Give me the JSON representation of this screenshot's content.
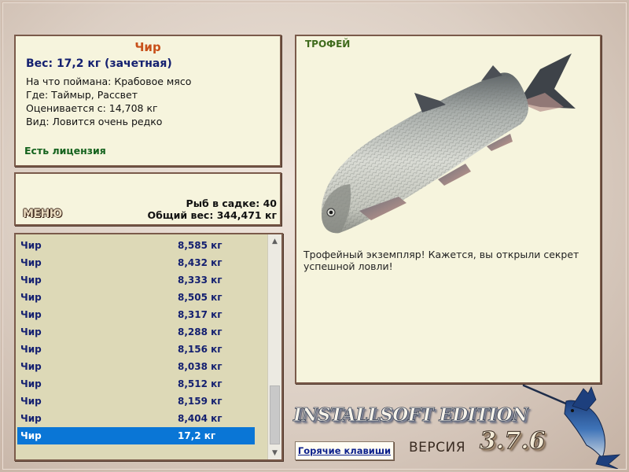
{
  "fish": {
    "name": "Чир",
    "weight": "Вес: 17,2 кг (зачетная)",
    "lines": [
      "На что поймана: Крабовое мясо",
      "Где: Таймыр, Рассвет",
      "Оценивается с: 14,708 кг",
      "Вид: Ловится очень редко"
    ],
    "license": "Есть лицензия"
  },
  "menu": {
    "label": "МЕНЮ",
    "keep_count": "Рыб в садке: 40",
    "total_weight": "Общий вес: 344,471 кг"
  },
  "catch_list": [
    {
      "name": "Чир",
      "weight": "8,585 кг"
    },
    {
      "name": "Чир",
      "weight": "8,432 кг"
    },
    {
      "name": "Чир",
      "weight": "8,333 кг"
    },
    {
      "name": "Чир",
      "weight": "8,505 кг"
    },
    {
      "name": "Чир",
      "weight": "8,317 кг"
    },
    {
      "name": "Чир",
      "weight": "8,288 кг"
    },
    {
      "name": "Чир",
      "weight": "8,156 кг"
    },
    {
      "name": "Чир",
      "weight": "8,038 кг"
    },
    {
      "name": "Чир",
      "weight": "8,512 кг"
    },
    {
      "name": "Чир",
      "weight": "8,159 кг"
    },
    {
      "name": "Чир",
      "weight": "8,404 кг"
    },
    {
      "name": "Чир",
      "weight": "17,2 кг"
    }
  ],
  "selected_index": 11,
  "trophy": {
    "title": "ТРОФЕЙ",
    "description": "Трофейный экземпляр! Кажется, вы открыли секрет успешной ловли!"
  },
  "branding": {
    "edition": "INSTALLSOFT EDITION",
    "version_label": "ВЕРСИЯ",
    "version_number": "3.7.6"
  },
  "hotkeys_label": "Горячие клавиши",
  "icons": {
    "scroll_up": "chevron-up-icon",
    "scroll_down": "chevron-down-icon"
  },
  "colors": {
    "selection": "#0a76d6",
    "panel": "#f6f4dd",
    "list_bg": "#ddd9b7",
    "title_accent": "#c8501a",
    "weight_text": "#142070",
    "license_text": "#14621d"
  }
}
